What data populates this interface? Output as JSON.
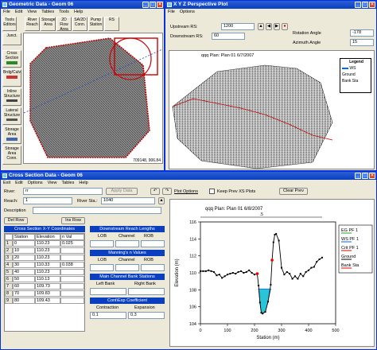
{
  "geom_window": {
    "title": "Geometric Data - Geom 06",
    "menu": [
      "File",
      "Edit",
      "View",
      "Tables",
      "Tools",
      "Help"
    ],
    "left_tools": [
      "Junct.",
      "Cross Section",
      "Brdg/Culv",
      "Inline Structure",
      "Lateral Structure",
      "Storage Area",
      "Storage Area Conn."
    ],
    "top_tools": [
      "River Reach",
      "Storage Area",
      "2D Flow Area",
      "SA/2D Conn.",
      "Pump Station",
      "RS"
    ],
    "top_tool_left": "Tools",
    "top_tool_left2": "Editors",
    "status_coords": "709148, 906.84"
  },
  "xyz_window": {
    "title": "X Y Z Perspective Plot",
    "menu": [
      "File",
      "Options"
    ],
    "upstream_label": "Upstream RS:",
    "upstream_value": "1200",
    "downstream_label": "Downstream RS:",
    "downstream_value": "60",
    "rotation_label": "Rotation Angle",
    "rotation_value": "-178",
    "azimuth_label": "Azimuth Angle",
    "azimuth_value": "15",
    "plot_title": "qqq     Plan: Plan 01     6/7/2007",
    "legend": {
      "title": "Legend",
      "items": [
        "WS",
        "Ground",
        "Bank Sta"
      ]
    }
  },
  "xs_window": {
    "title": "Cross Section Data - Geom 06",
    "menu": [
      "Exit",
      "Edit",
      "Options",
      "View",
      "Tables",
      "Help"
    ],
    "river_label": "River:",
    "river_value": "rr",
    "apply_button": "Apply Data",
    "plot_options": "Plot Options",
    "keep_prev": "Keep Prev XS Plots",
    "clear_prev": "Clear Prev",
    "reach_label": "Reach:",
    "reach_value": "1",
    "river_sta_label": "River Sta.:",
    "river_sta_value": "1040",
    "description_label": "Description",
    "del_row": "Del Row",
    "ins_row": "Ins Row",
    "coords_header": "Cross Section X-Y Coordinates",
    "table_cols": [
      "",
      "Station",
      "Elevation",
      "n Val"
    ],
    "table_rows": [
      [
        "1",
        "0",
        "110.23",
        "0.025"
      ],
      [
        "2",
        "10",
        "110.23",
        ""
      ],
      [
        "3",
        "20",
        "110.23",
        ""
      ],
      [
        "4",
        "30",
        "110.33",
        "0.038"
      ],
      [
        "5",
        "40",
        "110.23",
        ""
      ],
      [
        "6",
        "50",
        "110.13",
        ""
      ],
      [
        "7",
        "60",
        "109.73",
        ""
      ],
      [
        "8",
        "70",
        "109.83",
        ""
      ],
      [
        "9",
        "80",
        "109.43",
        ""
      ]
    ],
    "reach_lengths_header": "Downstream Reach Lengths",
    "reach_cols": [
      "LOB",
      "Channel",
      "ROB"
    ],
    "mannings_header": "Manning's n Values",
    "mannings_cols": [
      "LOB",
      "Channel",
      "ROB"
    ],
    "bank_header": "Main Channel Bank Stations",
    "bank_cols": [
      "Left Bank",
      "Right Bank"
    ],
    "cont_header": "Cont\\Exp Coefficient",
    "cont_cols": [
      "Contraction",
      "Expansion"
    ],
    "cont_values": [
      "0.1",
      "0.3"
    ]
  },
  "chart_data": {
    "type": "line",
    "title": "qqq     Plan: Plan 01     6/8/2007",
    "xlabel": "Station (m)",
    "ylabel": "Elevation (m)",
    "xlim": [
      0,
      500
    ],
    "ylim": [
      104,
      116
    ],
    "xticks": [
      "0",
      "100",
      "200",
      "300",
      "400",
      "500"
    ],
    "yticks": [
      "104",
      "106",
      "108",
      "110",
      "112",
      "114",
      "116"
    ],
    "series": [
      {
        "name": "Ground",
        "x": [
          0,
          10,
          20,
          30,
          40,
          50,
          60,
          70,
          80,
          90,
          100,
          110,
          120,
          130,
          140,
          150,
          160,
          170,
          180,
          190,
          200,
          210,
          215,
          220,
          225,
          230,
          240,
          250,
          260,
          265,
          270,
          275,
          280,
          290,
          300,
          310,
          320,
          330,
          340,
          350,
          360,
          370,
          380,
          390,
          400,
          410,
          420,
          430,
          440,
          450
        ],
        "y": [
          110.2,
          110.2,
          110.2,
          110.3,
          110.2,
          110.1,
          109.7,
          109.8,
          109.4,
          109.6,
          109.8,
          109.9,
          110.0,
          109.9,
          110.1,
          110.2,
          110.0,
          110.1,
          110.3,
          110.0,
          109.8,
          109.9,
          108.5,
          106.5,
          105.3,
          105.2,
          105.4,
          106.6,
          108.6,
          111.5,
          113.6,
          114.5,
          114.6,
          113.8,
          110.6,
          109.8,
          110.1,
          109.9,
          109.3,
          109.6,
          109.3,
          109.9,
          109.6,
          110.1,
          110.3,
          110.6,
          110.7,
          111.3,
          111.6,
          111.8
        ]
      }
    ],
    "water_surface": {
      "name": "WS PF 1",
      "x_from": 213,
      "x_to": 262,
      "y": 108.1
    },
    "legend": [
      "EG PF 1",
      "WS PF 1",
      "Crit PF 1",
      "Ground",
      "Bank Sta"
    ],
    "bracket_label": ".5"
  }
}
